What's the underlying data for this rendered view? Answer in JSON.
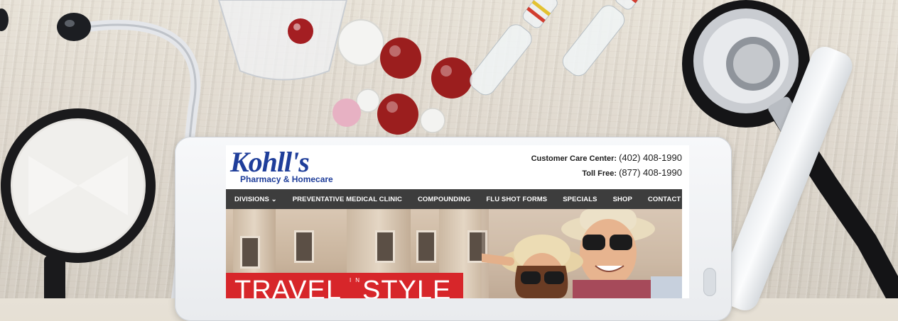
{
  "site": {
    "logo_main": "Kohll's",
    "logo_sub": "Pharmacy & Homecare"
  },
  "contact": {
    "care_label": "Customer Care Center:",
    "care_number": "(402) 408-1990",
    "tollfree_label": "Toll Free:",
    "tollfree_number": "(877) 408-1990"
  },
  "nav": {
    "items": [
      {
        "label": "DIVISIONS ⌄"
      },
      {
        "label": "PREVENTATIVE MEDICAL CLINIC"
      },
      {
        "label": "COMPOUNDING"
      },
      {
        "label": "FLU SHOT FORMS"
      },
      {
        "label": "SPECIALS"
      },
      {
        "label": "SHOP"
      },
      {
        "label": "CONTACT"
      }
    ]
  },
  "hero": {
    "word1": "TRAVEL",
    "word_in": "IN",
    "word2": "STYLE"
  },
  "colors": {
    "brand_blue": "#1f3e9a",
    "nav_bg": "#3d3d3d",
    "banner_red": "#d7262a",
    "pill_red": "#9b1e1e"
  }
}
